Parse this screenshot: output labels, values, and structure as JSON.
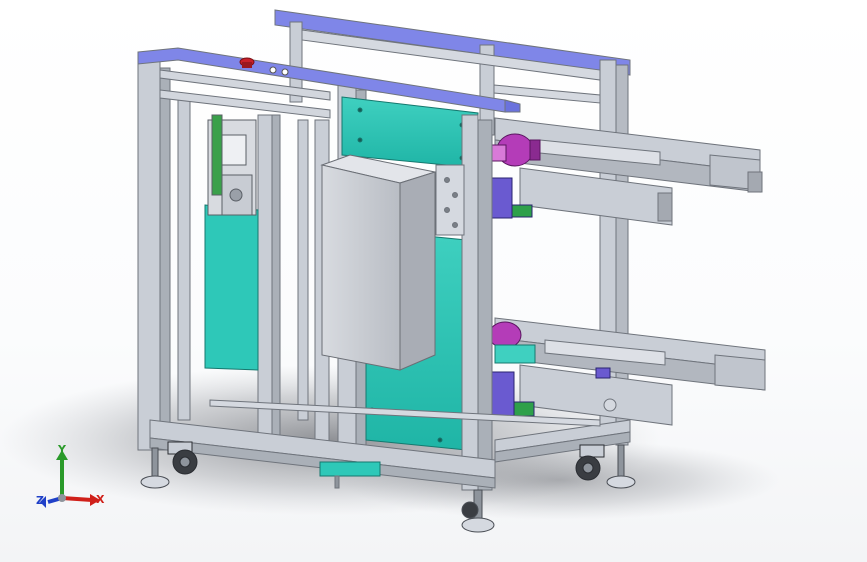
{
  "viewport": {
    "background": "#ffffff",
    "model": {
      "frame_color": "#c9ced6",
      "frame_dark": "#8e949c",
      "top_plate_color": "#7f86e8",
      "teal_panel_color": "#2ec8b8",
      "teal_panel_light": "#4fd5c6",
      "box_color": "#cfd2d8",
      "box_shade": "#b5b9c0",
      "motor_color": "#b43cb8",
      "block_color": "#6a5ad0",
      "rail_color": "#bfc4cc",
      "estop_color": "#c8202a",
      "wheel_color": "#3a3d42"
    }
  },
  "triad": {
    "x_label": "X",
    "y_label": "Y",
    "z_label": "Z",
    "x_color": "#d0201a",
    "y_color": "#2a9a2a",
    "z_color": "#2040c8"
  }
}
